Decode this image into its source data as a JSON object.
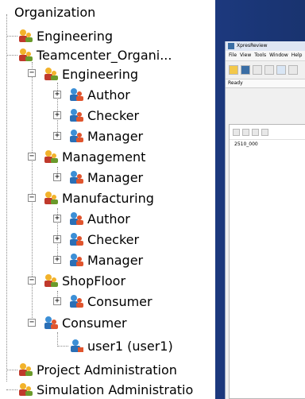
{
  "tree": {
    "items": [
      {
        "label": "Organization",
        "icon": "org-root-icon"
      },
      {
        "label": "Engineering",
        "icon": "group-icon"
      },
      {
        "label": "Teamcenter_Organi...",
        "icon": "group-icon"
      },
      {
        "label": "Engineering",
        "icon": "group-icon"
      },
      {
        "label": "Author",
        "icon": "role-icon"
      },
      {
        "label": "Checker",
        "icon": "role-icon"
      },
      {
        "label": "Manager",
        "icon": "role-icon"
      },
      {
        "label": "Management",
        "icon": "group-icon"
      },
      {
        "label": "Manager",
        "icon": "role-icon"
      },
      {
        "label": "Manufacturing",
        "icon": "group-icon"
      },
      {
        "label": "Author",
        "icon": "role-icon"
      },
      {
        "label": "Checker",
        "icon": "role-icon"
      },
      {
        "label": "Manager",
        "icon": "role-icon"
      },
      {
        "label": "ShopFloor",
        "icon": "group-icon"
      },
      {
        "label": "Consumer",
        "icon": "role-icon"
      },
      {
        "label": "Consumer",
        "icon": "role-icon"
      },
      {
        "label": "user1 (user1)",
        "icon": "user-icon"
      },
      {
        "label": "Project Administration",
        "icon": "group-icon"
      },
      {
        "label": "Simulation Administratio",
        "icon": "group-icon"
      }
    ]
  },
  "miniwindow": {
    "title": "XpresReview",
    "menu": [
      "File",
      "View",
      "Tools",
      "Window",
      "Help"
    ],
    "status": "Ready",
    "tree_item": "2510_000"
  },
  "colors": {
    "background": "#1f3f8a",
    "tree_bg": "#ffffff",
    "group_person_head": "#f2b22b",
    "role_person_head": "#3c8fd6"
  }
}
